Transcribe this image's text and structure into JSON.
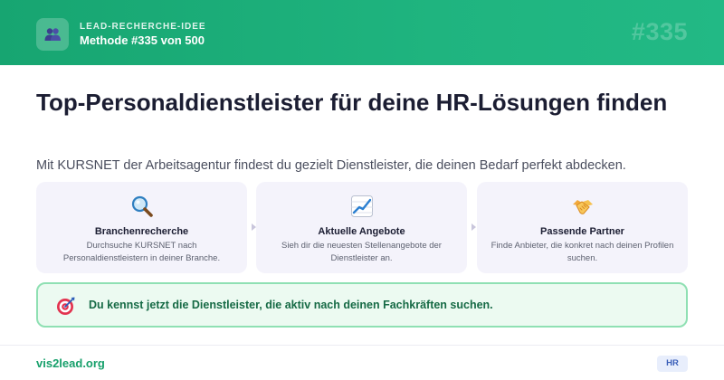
{
  "header": {
    "icon": "people-icon",
    "kicker": "LEAD-RECHERCHE-IDEE",
    "method": "Methode #335 von 500",
    "number": "#335"
  },
  "main": {
    "title": "Top-Personaldienstleister für deine HR-Lösungen finden",
    "subtitle": "Mit KURSNET der Arbeitsagentur findest du gezielt Dienstleister, die deinen Bedarf perfekt abdecken."
  },
  "steps": [
    {
      "icon": "magnifier-icon",
      "title": "Branchenrecherche",
      "description": "Durchsuche KURSNET nach Personaldienstleistern in deiner Branche."
    },
    {
      "icon": "chart-increasing-icon",
      "title": "Aktuelle Angebote",
      "description": "Sieh dir die neuesten Stellenangebote der Dienstleister an."
    },
    {
      "icon": "handshake-icon",
      "title": "Passende Partner",
      "description": "Finde Anbieter, die konkret nach deinen Profilen suchen."
    }
  ],
  "callout": {
    "icon": "target-icon",
    "text": "Du kennst jetzt die Dienstleister, die aktiv nach deinen Fachkräften suchen."
  },
  "footer": {
    "site": "vis2lead.org",
    "tag": "HR"
  },
  "colors": {
    "brand_green": "#17a571",
    "callout_border": "#8fe0b3",
    "card_background": "#f4f3fb",
    "tag_blue": "#3a5fb8"
  }
}
